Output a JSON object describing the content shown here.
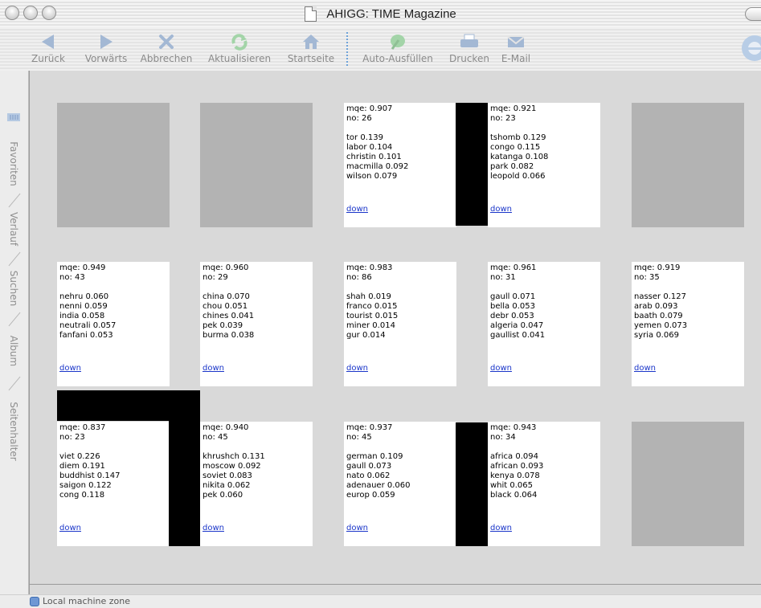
{
  "window": {
    "title": "AHIGG: TIME Magazine"
  },
  "toolbar": {
    "back": "Zurück",
    "forward": "Vorwärts",
    "stop": "Abbrechen",
    "refresh": "Aktualisieren",
    "home": "Startseite",
    "autofill": "Auto-Ausfüllen",
    "print": "Drucken",
    "mail": "E-Mail"
  },
  "drawer": {
    "favorites": "Favoriten",
    "history": "Verlauf",
    "search": "Suchen",
    "album": "Album",
    "page_holder": "Seitenhalter"
  },
  "grid": {
    "row1": [
      {
        "type": "empty"
      },
      {
        "type": "empty"
      },
      {
        "type": "cluster",
        "mqe": "mqe: 0.907",
        "no": "no: 26",
        "terms": [
          "tor 0.139",
          "labor 0.104",
          "christin 0.101",
          "macmilla 0.092",
          "wilson 0.079"
        ],
        "link": "down"
      },
      {
        "type": "cluster",
        "mqe": "mqe: 0.921",
        "no": "no: 23",
        "terms": [
          "tshomb 0.129",
          "congo 0.115",
          "katanga 0.108",
          "park 0.082",
          "leopold 0.066"
        ],
        "link": "down"
      },
      {
        "type": "empty"
      }
    ],
    "row2": [
      {
        "type": "cluster",
        "mqe": "mqe: 0.949",
        "no": "no: 43",
        "terms": [
          "nehru 0.060",
          "nenni 0.059",
          "india 0.058",
          "neutrali 0.057",
          "fanfani 0.053"
        ],
        "link": "down"
      },
      {
        "type": "cluster",
        "mqe": "mqe: 0.960",
        "no": "no: 29",
        "terms": [
          "china 0.070",
          "chou 0.051",
          "chines 0.041",
          "pek 0.039",
          "burma 0.038"
        ],
        "link": "down"
      },
      {
        "type": "cluster",
        "mqe": "mqe: 0.983",
        "no": "no: 86",
        "terms": [
          "shah 0.019",
          "franco 0.015",
          "tourist 0.015",
          "miner 0.014",
          "gur 0.014"
        ],
        "link": "down"
      },
      {
        "type": "cluster",
        "mqe": "mqe: 0.961",
        "no": "no: 31",
        "terms": [
          "gaull 0.071",
          "bella 0.053",
          "debr 0.053",
          "algeria 0.047",
          "gaullist 0.041"
        ],
        "link": "down"
      },
      {
        "type": "cluster",
        "mqe": "mqe: 0.919",
        "no": "no: 35",
        "terms": [
          "nasser 0.127",
          "arab 0.093",
          "baath 0.079",
          "yemen 0.073",
          "syria 0.069"
        ],
        "link": "down"
      }
    ],
    "row3": [
      {
        "type": "cluster",
        "mqe": "mqe: 0.837",
        "no": "no: 23",
        "terms": [
          "viet 0.226",
          "diem 0.191",
          "buddhist 0.147",
          "saigon 0.122",
          "cong 0.118"
        ],
        "link": "down"
      },
      {
        "type": "cluster",
        "mqe": "mqe: 0.940",
        "no": "no: 45",
        "terms": [
          "khrushch 0.131",
          "moscow 0.092",
          "soviet 0.083",
          "nikita 0.062",
          "pek 0.060"
        ],
        "link": "down"
      },
      {
        "type": "cluster",
        "mqe": "mqe: 0.937",
        "no": "no: 45",
        "terms": [
          "german 0.109",
          "gaull 0.073",
          "nato 0.062",
          "adenauer 0.060",
          "europ 0.059"
        ],
        "link": "down"
      },
      {
        "type": "cluster",
        "mqe": "mqe: 0.943",
        "no": "no: 34",
        "terms": [
          "africa 0.094",
          "african 0.093",
          "kenya 0.078",
          "whit 0.065",
          "black 0.064"
        ],
        "link": "down"
      },
      {
        "type": "empty"
      }
    ]
  },
  "status": {
    "zone": "Local machine zone"
  }
}
